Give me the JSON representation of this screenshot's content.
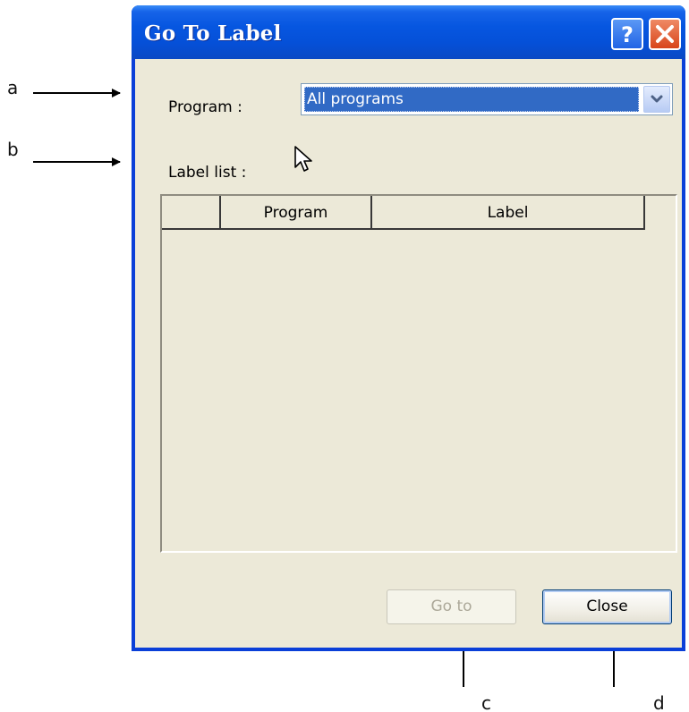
{
  "annotations": {
    "a": "a",
    "b": "b",
    "c": "c",
    "d": "d"
  },
  "window": {
    "title": "Go To Label",
    "help_icon": "question-mark-icon",
    "close_icon": "x-close-icon"
  },
  "form": {
    "program_label": "Program :",
    "program_value": "All programs",
    "label_list_label": "Label list :"
  },
  "table": {
    "columns": [
      "",
      "Program",
      "Label"
    ],
    "rows": []
  },
  "buttons": {
    "goto_label": "Go to",
    "close_label": "Close"
  },
  "colors": {
    "titlebar": "#0550d8",
    "selection": "#316ac5",
    "dialog_bg": "#ece9d8"
  }
}
